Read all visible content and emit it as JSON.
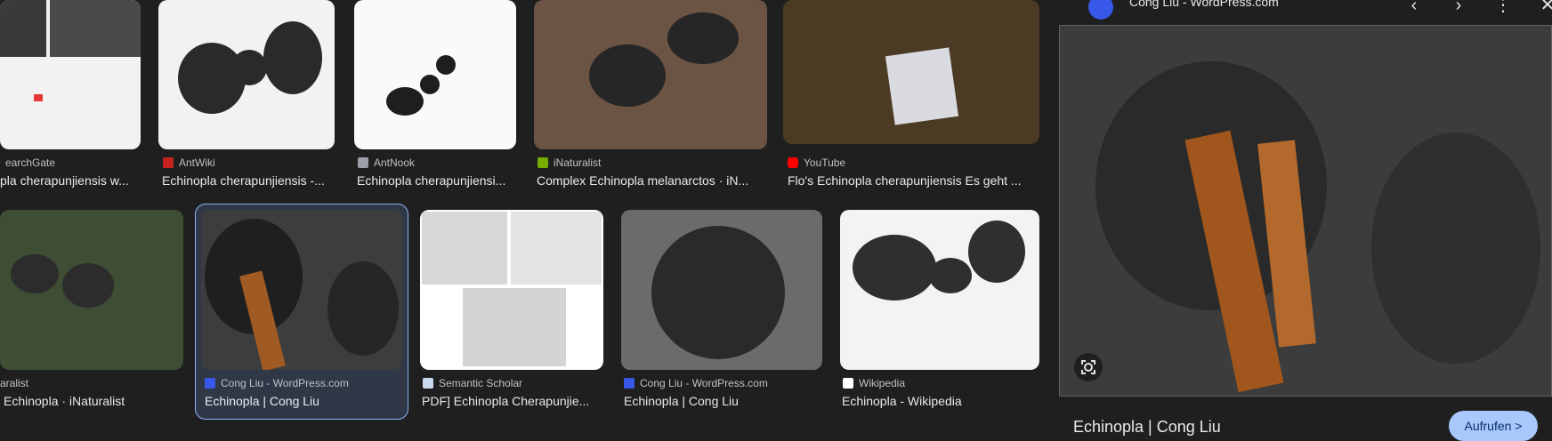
{
  "row1": [
    {
      "source": "earchGate",
      "title": "pla cherapunjiensis w...",
      "fav_color": "#00ccbb"
    },
    {
      "source": "AntWiki",
      "title": "Echinopla cherapunjiensis -...",
      "fav_color": "#c5221f"
    },
    {
      "source": "AntNook",
      "title": "Echinopla cherapunjiensi...",
      "fav_color": "#9aa0a6"
    },
    {
      "source": "iNaturalist",
      "title": "Complex Echinopla melanarctos · iN...",
      "fav_color": "#74ac00"
    },
    {
      "source": "YouTube",
      "title": "Flo's Echinopla cherapunjiensis Es geht ...",
      "fav_color": "#ff0000"
    }
  ],
  "row2": [
    {
      "source": "aralist",
      "title": "Echinopla · iNaturalist",
      "fav_color": "#74ac00"
    },
    {
      "source": "Cong Liu - WordPress.com",
      "title": "Echinopla | Cong Liu",
      "fav_color": "#3858e9"
    },
    {
      "source": "Semantic Scholar",
      "title": "PDF] Echinopla Cherapunjie...",
      "fav_color": "#c8d9f0"
    },
    {
      "source": "Cong Liu - WordPress.com",
      "title": "Echinopla | Cong Liu",
      "fav_color": "#3858e9"
    },
    {
      "source": "Wikipedia",
      "title": "Echinopla - Wikipedia",
      "fav_color": "#ffffff"
    }
  ],
  "panel": {
    "source": "Cong Liu - WordPress.com",
    "title": "Echinopla | Cong Liu",
    "visit_label": "Aufrufen >",
    "icons": {
      "prev": "chevron-left-icon",
      "next": "chevron-right-icon",
      "more": "more-vert-icon",
      "close": "close-icon",
      "lens": "lens-icon"
    }
  }
}
